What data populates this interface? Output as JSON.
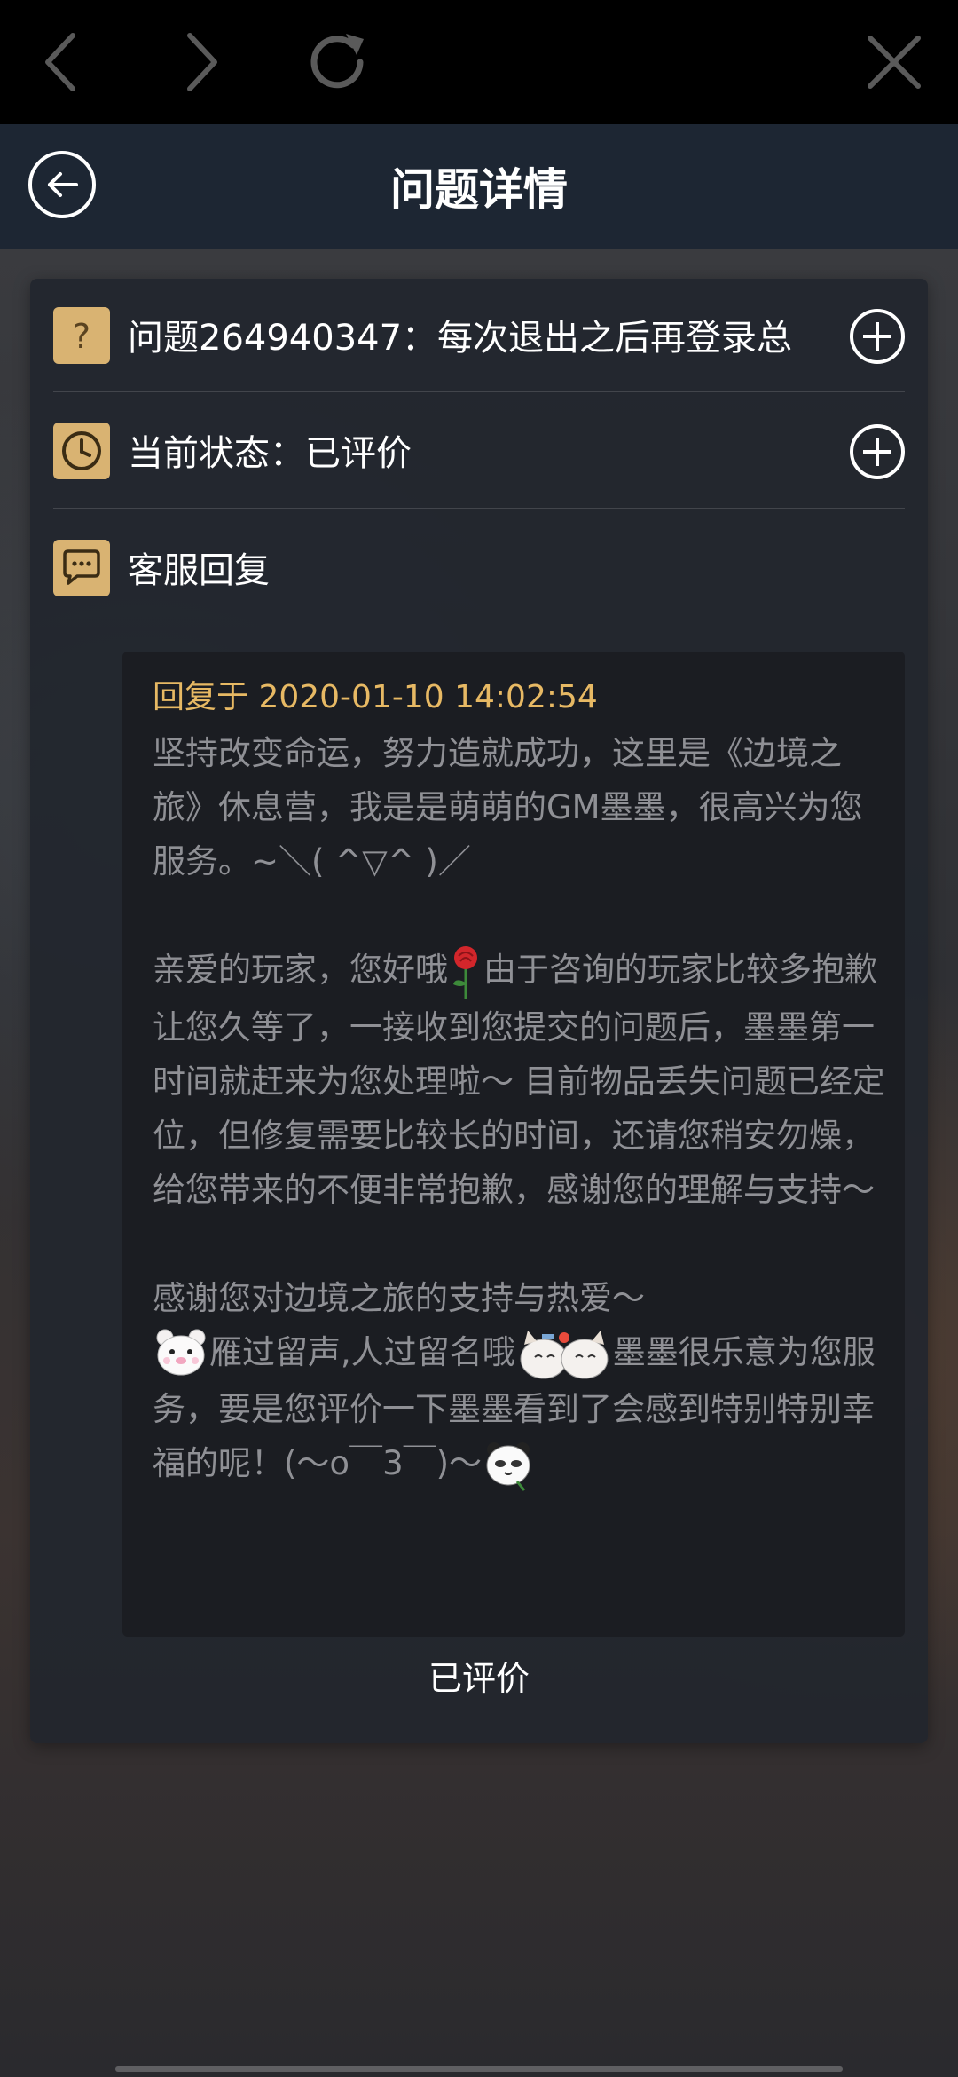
{
  "header": {
    "title": "问题详情"
  },
  "rows": {
    "question": "问题264940347：每次退出之后再登录总",
    "status": "当前状态：已评价",
    "reply_header": "客服回复"
  },
  "reply": {
    "date": "回复于 2020-01-10 14:02:54",
    "p1": "坚持改变命运，努力造就成功，这里是《边境之旅》休息营，我是是萌萌的GM墨墨，很高兴为您服务。~＼( ^▽^ )／",
    "p2_a": "亲爱的玩家，您好哦",
    "p2_b": "由于咨询的玩家比较多抱歉让您久等了，一接收到您提交的问题后，墨墨第一时间就赶来为您处理啦～ 目前物品丢失问题已经定位，但修复需要比较长的时间，还请您稍安勿燥，给您带来的不便非常抱歉，感谢您的理解与支持～",
    "p3": "感谢您对边境之旅的支持与热爱～",
    "p4_a": "雁过留声,人过留名哦",
    "p4_b": "墨墨很乐意为您服务，要是您评价一下墨墨看到了会感到特别特别幸福的呢！(～o￣3￣)～"
  },
  "footer": {
    "status_label": "已评价"
  },
  "colors": {
    "accent": "#d9b372",
    "date": "#e7b964",
    "header_bg": "#1d2633",
    "body_text": "#8f9095"
  },
  "icons": {
    "browser_back": "chevron-left-icon",
    "browser_forward": "chevron-right-icon",
    "browser_reload": "reload-icon",
    "browser_close": "close-icon",
    "page_back": "arrow-left-circle-icon",
    "question": "question-icon",
    "status": "clock-icon",
    "reply": "chat-bubble-icon",
    "expand": "plus-circle-icon"
  }
}
